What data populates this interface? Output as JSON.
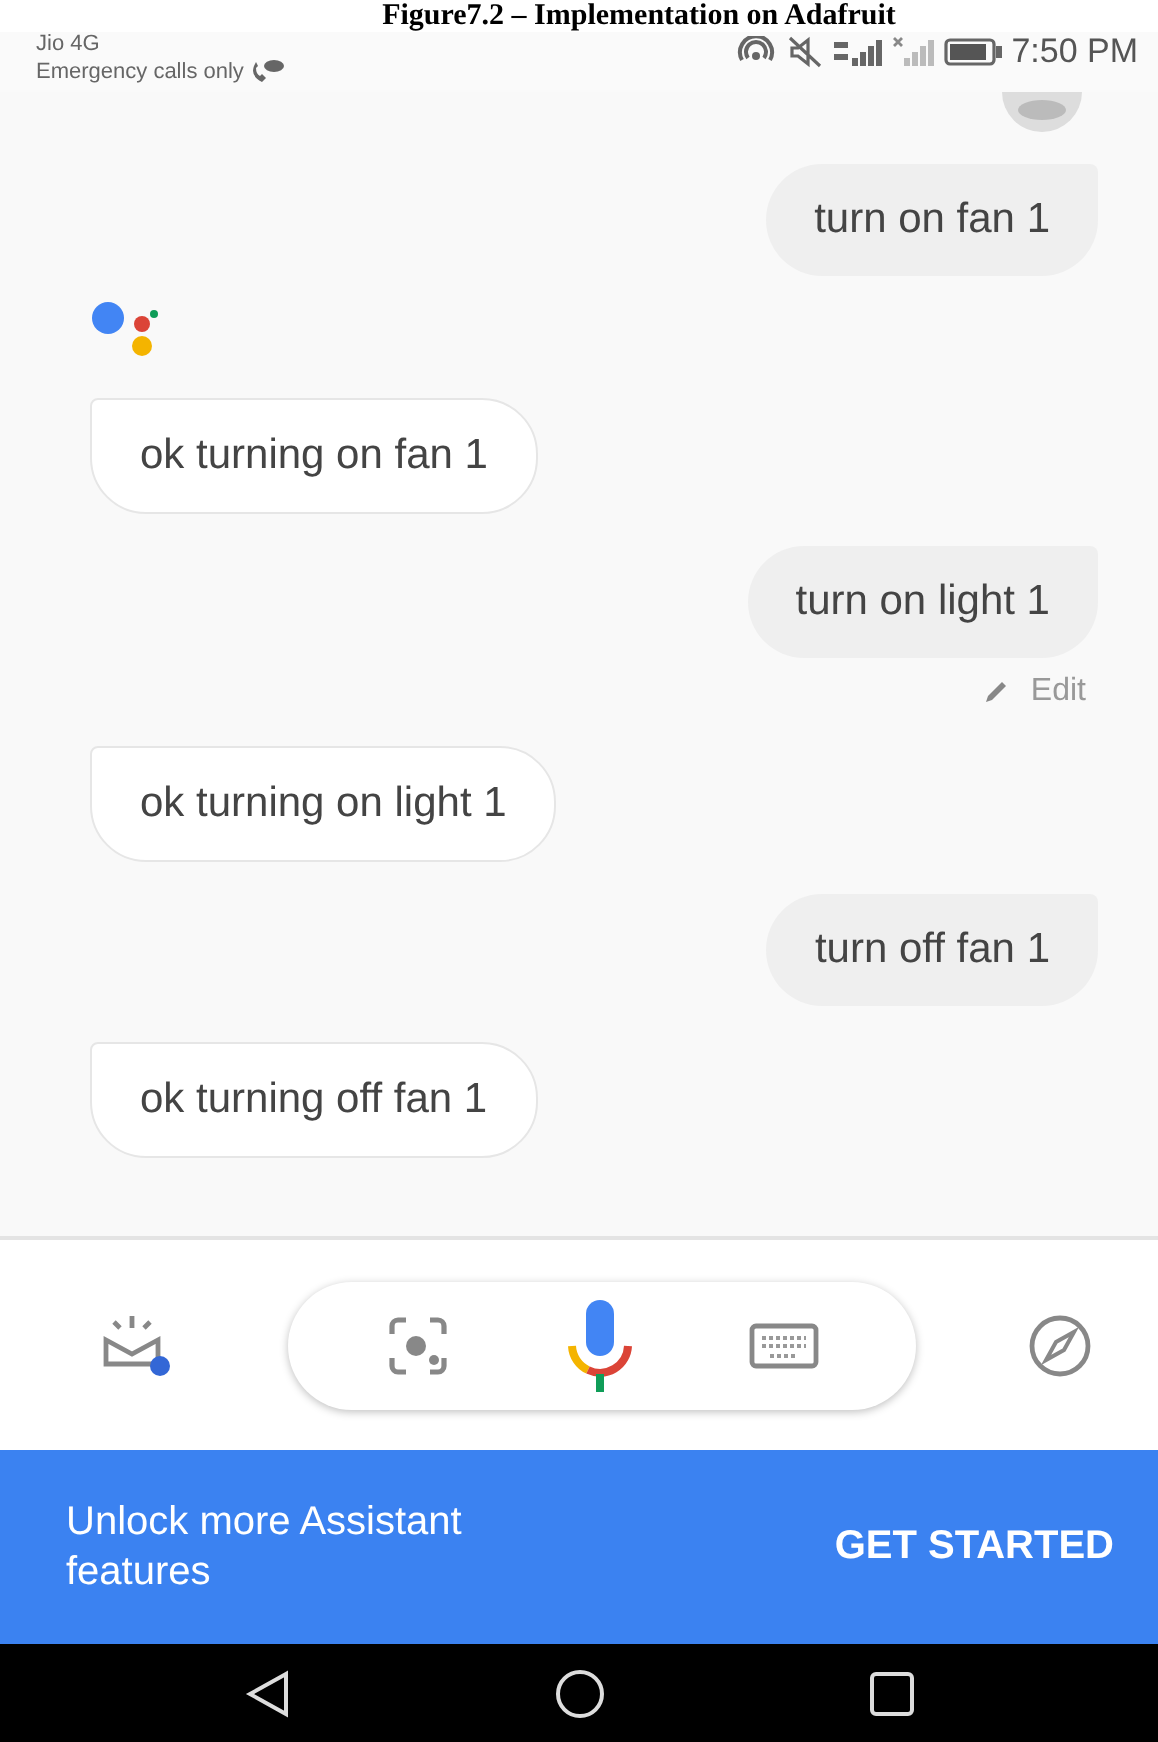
{
  "caption": "Figure7.2 – Implementation on Adafruit",
  "status_bar": {
    "carrier": "Jio 4G",
    "note": "Emergency calls only",
    "time": "7:50 PM"
  },
  "messages": [
    {
      "kind": "user",
      "text": "turn on fan 1"
    },
    {
      "kind": "logo"
    },
    {
      "kind": "assistant",
      "text": "ok turning on fan 1"
    },
    {
      "kind": "user",
      "text": "turn on light 1",
      "edit": "Edit"
    },
    {
      "kind": "assistant",
      "text": "ok turning on light 1"
    },
    {
      "kind": "user",
      "text": "turn off fan 1"
    },
    {
      "kind": "assistant",
      "text": "ok turning off fan 1"
    }
  ],
  "banner": {
    "text": "Unlock more Assistant features",
    "button": "GET STARTED"
  }
}
